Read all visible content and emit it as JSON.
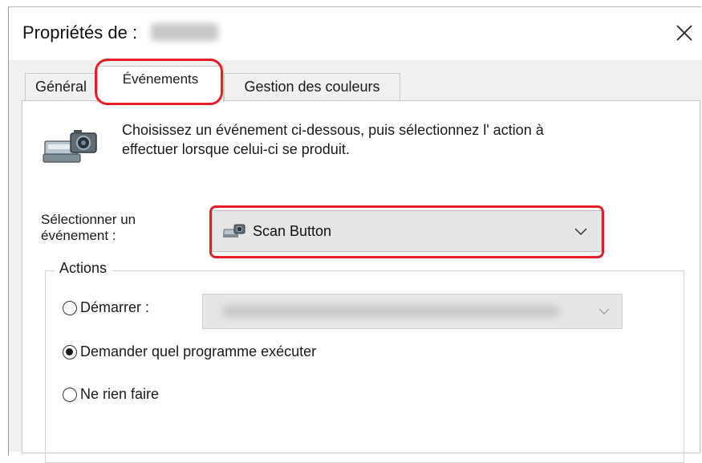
{
  "window": {
    "title": "Propriétés de :",
    "close_label": "×"
  },
  "tabs": [
    {
      "label": "Général",
      "selected": false
    },
    {
      "label": "Événements",
      "selected": true
    },
    {
      "label": "Gestion des couleurs",
      "selected": false
    }
  ],
  "events_tab": {
    "description_line1": "Choisissez un événement ci-dessous, puis sélectionnez l' action à",
    "description_line2": "effectuer lorsque celui-ci se produit.",
    "select_label_line1": "Sélectionner un",
    "select_label_line2": "événement :",
    "selected_event": "Scan Button",
    "actions": {
      "legend": "Actions",
      "options": [
        {
          "label": "Démarrer :",
          "checked": false
        },
        {
          "label": "Demander quel programme exécuter",
          "checked": true
        },
        {
          "label": "Ne rien faire",
          "checked": false
        }
      ]
    }
  },
  "colors": {
    "annotation": "#e41e26",
    "panel_bg": "#f0f0f0"
  },
  "icons": {
    "scanner": "scanner-camera-icon",
    "close": "close-icon",
    "chevron": "chevron-down-icon"
  }
}
